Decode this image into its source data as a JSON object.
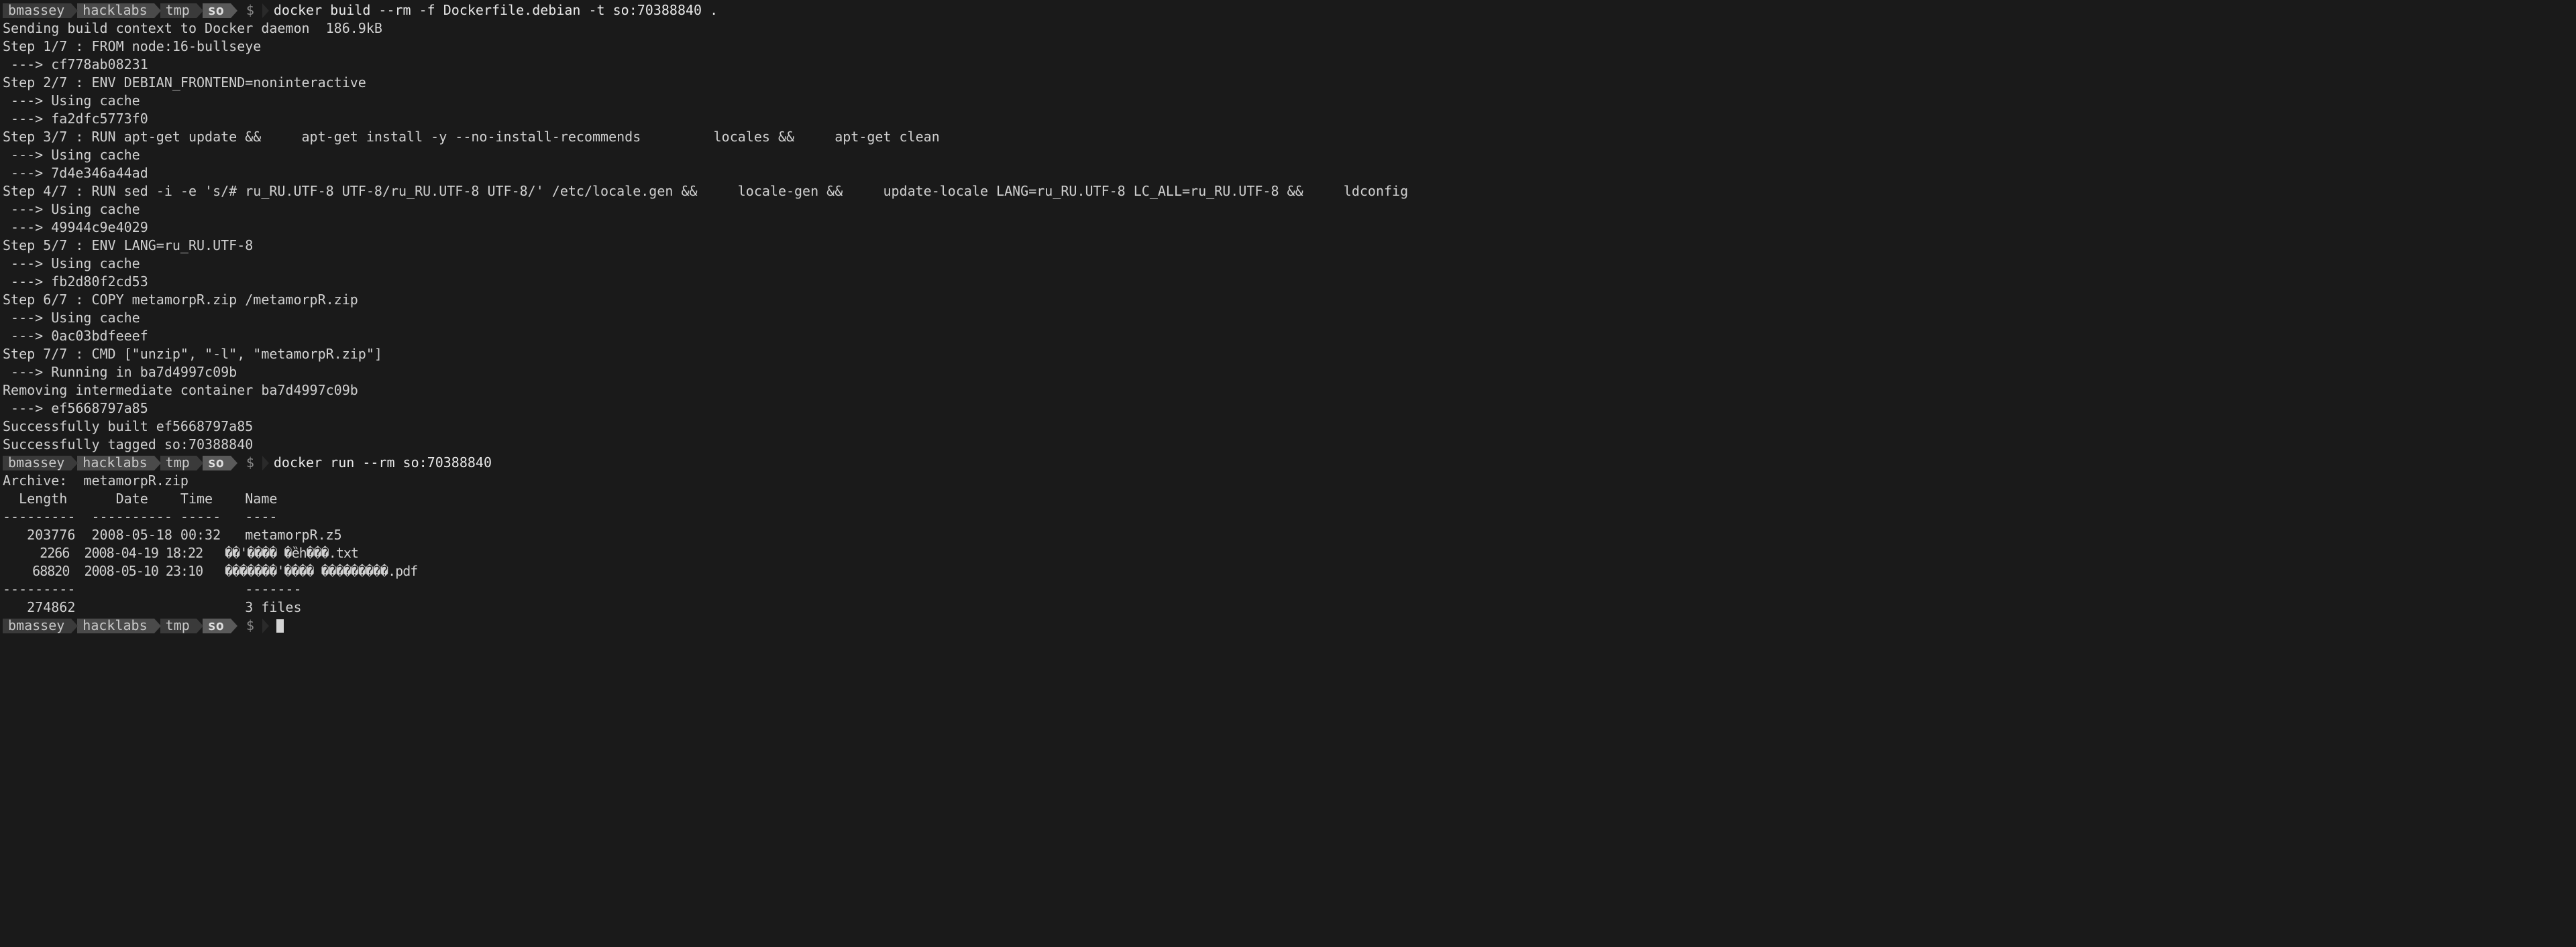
{
  "prompts": [
    {
      "segments": [
        "bmassey",
        "hacklabs",
        "tmp",
        "so"
      ],
      "command": "docker build --rm -f Dockerfile.debian -t so:70388840 ."
    },
    {
      "segments": [
        "bmassey",
        "hacklabs",
        "tmp",
        "so"
      ],
      "command": "docker run --rm so:70388840"
    },
    {
      "segments": [
        "bmassey",
        "hacklabs",
        "tmp",
        "so"
      ],
      "command": ""
    }
  ],
  "dollar": "$",
  "build_output": [
    "Sending build context to Docker daemon  186.9kB",
    "Step 1/7 : FROM node:16-bullseye",
    " ---> cf778ab08231",
    "Step 2/7 : ENV DEBIAN_FRONTEND=noninteractive",
    " ---> Using cache",
    " ---> fa2dfc5773f0",
    "Step 3/7 : RUN apt-get update &&     apt-get install -y --no-install-recommends         locales &&     apt-get clean",
    " ---> Using cache",
    " ---> 7d4e346a44ad",
    "Step 4/7 : RUN sed -i -e 's/# ru_RU.UTF-8 UTF-8/ru_RU.UTF-8 UTF-8/' /etc/locale.gen &&     locale-gen &&     update-locale LANG=ru_RU.UTF-8 LC_ALL=ru_RU.UTF-8 &&     ldconfig",
    " ---> Using cache",
    " ---> 49944c9e4029",
    "Step 5/7 : ENV LANG=ru_RU.UTF-8",
    " ---> Using cache",
    " ---> fb2d80f2cd53",
    "Step 6/7 : COPY metamorpR.zip /metamorpR.zip",
    " ---> Using cache",
    " ---> 0ac03bdfeeef",
    "Step 7/7 : CMD [\"unzip\", \"-l\", \"metamorpR.zip\"]",
    " ---> Running in ba7d4997c09b",
    "Removing intermediate container ba7d4997c09b",
    " ---> ef5668797a85",
    "Successfully built ef5668797a85",
    "Successfully tagged so:70388840"
  ],
  "run_output": [
    "Archive:  metamorpR.zip",
    "  Length      Date    Time    Name",
    "---------  ---------- -----   ----",
    "   203776  2008-05-18 00:32   metamorpR.z5",
    "     2266  2008-04-19 18:22   ��'���� �ȅh���.txt",
    "    68820  2008-05-10 23:10   �������'���� ���������.pdf",
    "---------                     -------",
    "   274862                     3 files"
  ]
}
